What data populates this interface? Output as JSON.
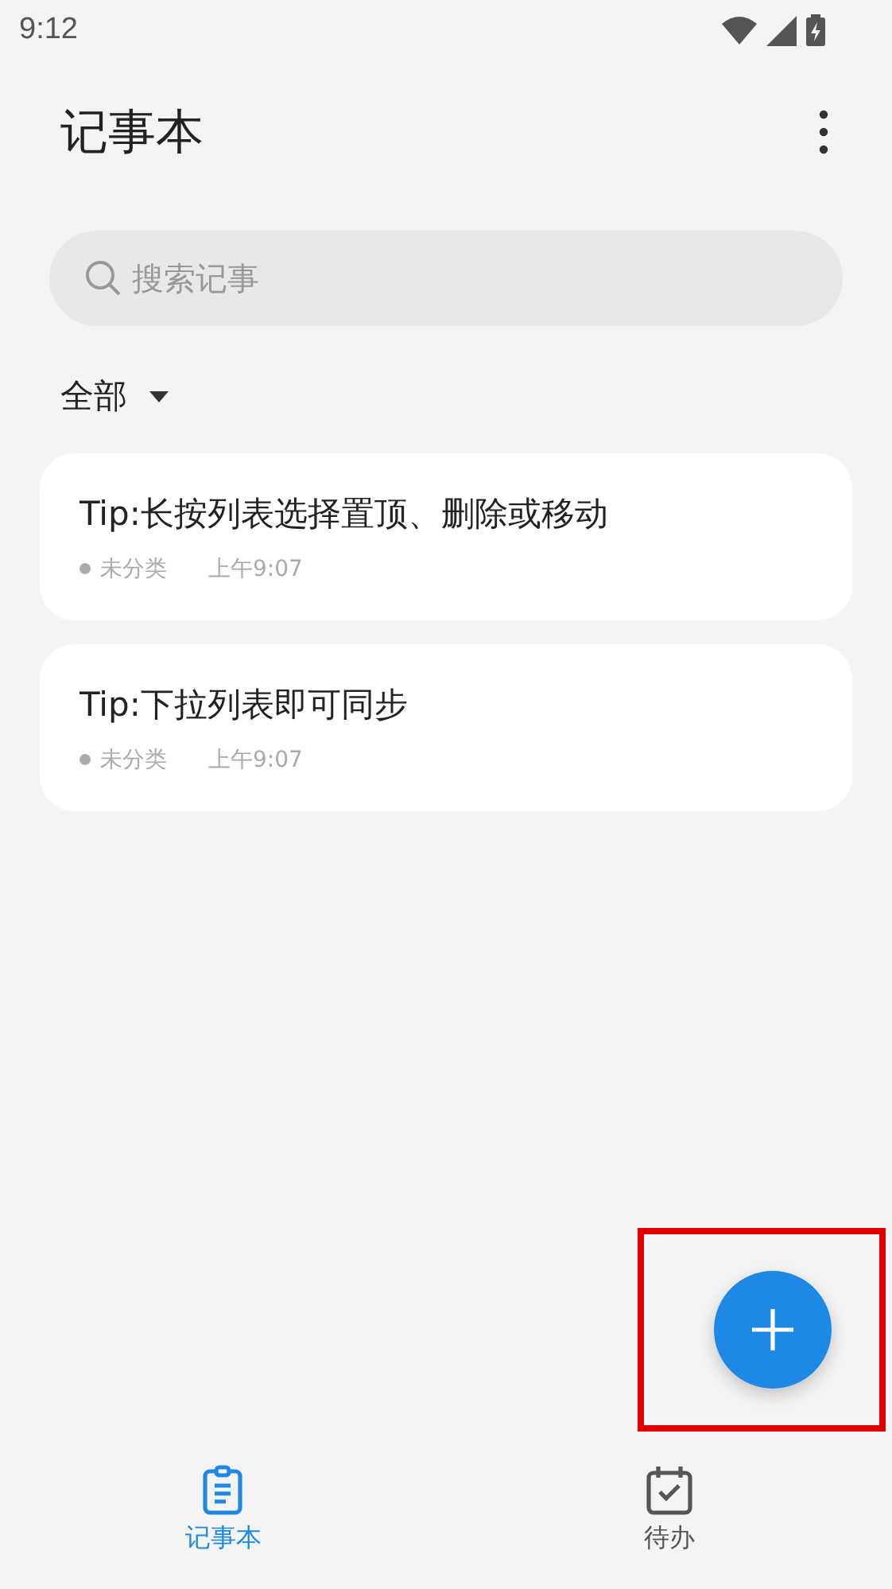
{
  "status_bar": {
    "time": "9:12"
  },
  "header": {
    "title": "记事本"
  },
  "search": {
    "placeholder": "搜索记事"
  },
  "filter": {
    "label": "全部"
  },
  "notes": [
    {
      "title": "Tip:长按列表选择置顶、删除或移动",
      "category": "未分类",
      "time": "上午9:07"
    },
    {
      "title": "Tip:下拉列表即可同步",
      "category": "未分类",
      "time": "上午9:07"
    }
  ],
  "highlight": {
    "on": true
  },
  "tabs": [
    {
      "kind": "notes",
      "label": "记事本",
      "selected": true
    },
    {
      "kind": "todo",
      "label": "待办",
      "selected": false
    }
  ]
}
